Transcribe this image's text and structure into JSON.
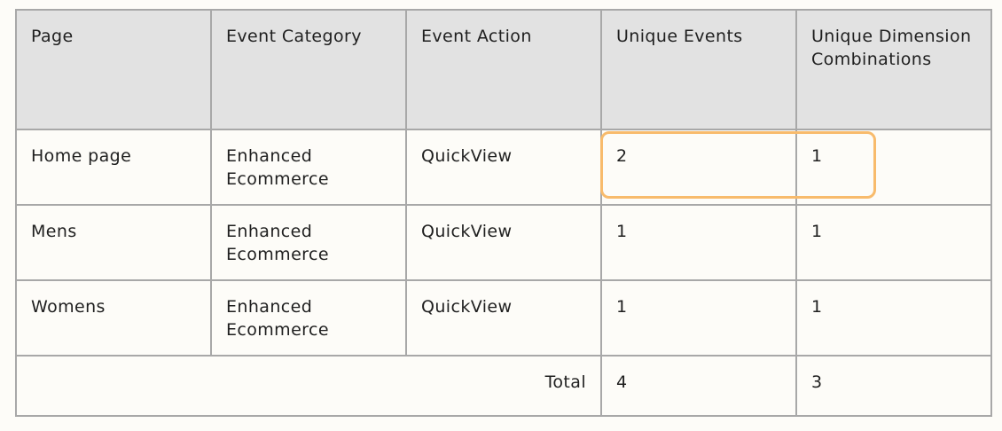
{
  "table": {
    "headers": [
      "Page",
      "Event Category",
      "Event Action",
      "Unique Events",
      "Unique Dimension Combinations"
    ],
    "rows": [
      {
        "page": "Home page",
        "category": "Enhanced Ecommerce",
        "action": "QuickView",
        "unique_events": "2",
        "unique_combinations": "1"
      },
      {
        "page": "Mens",
        "category": "Enhanced Ecommerce",
        "action": "QuickView",
        "unique_events": "1",
        "unique_combinations": "1"
      },
      {
        "page": "Womens",
        "category": "Enhanced Ecommerce",
        "action": "QuickView",
        "unique_events": "1",
        "unique_combinations": "1"
      }
    ],
    "total": {
      "label": "Total",
      "unique_events": "4",
      "unique_combinations": "3"
    }
  },
  "highlight": {
    "row": 0,
    "color": "#f8bb6c"
  }
}
